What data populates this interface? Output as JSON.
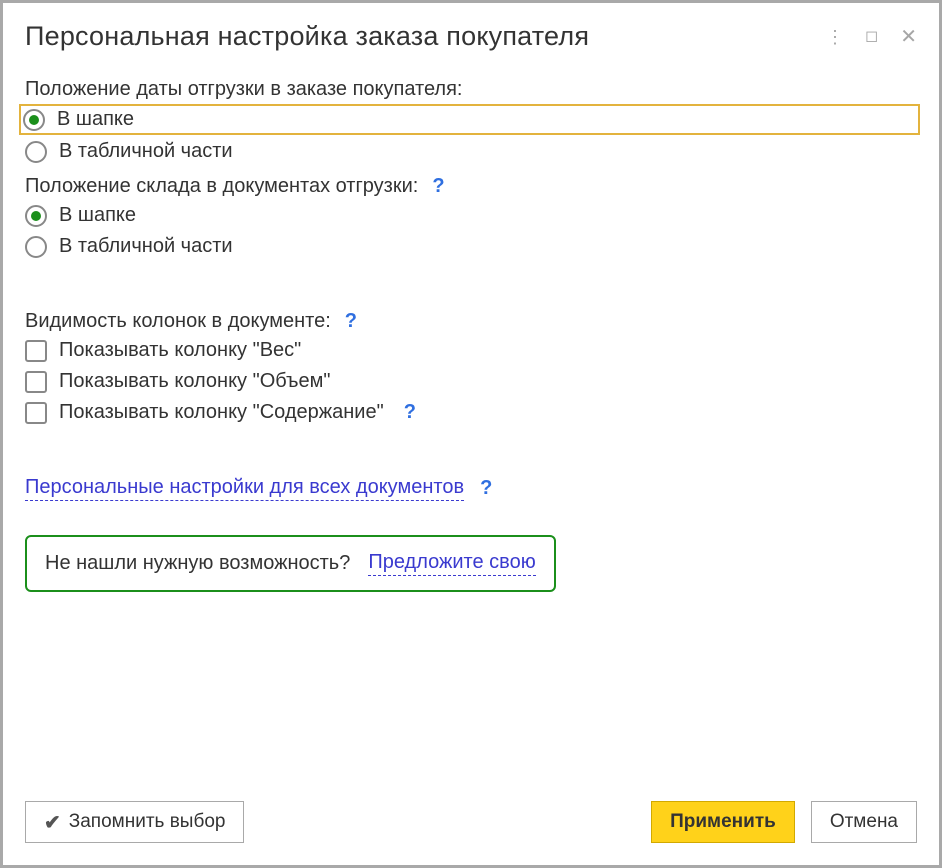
{
  "window": {
    "title": "Персональная настройка заказа покупателя"
  },
  "section1": {
    "label": "Положение даты отгрузки в заказе покупателя:",
    "opt1": "В шапке",
    "opt2": "В табличной части"
  },
  "section2": {
    "label": "Положение склада в документах отгрузки:",
    "opt1": "В шапке",
    "opt2": "В табличной части"
  },
  "section3": {
    "label": "Видимость колонок в документе:",
    "chk1": "Показывать колонку \"Вес\"",
    "chk2": "Показывать колонку \"Объем\"",
    "chk3": "Показывать колонку \"Содержание\""
  },
  "links": {
    "all_docs": "Персональные настройки для всех документов"
  },
  "suggest": {
    "text": "Не нашли нужную возможность?",
    "link": "Предложите свою"
  },
  "buttons": {
    "remember": "Запомнить выбор",
    "apply": "Применить",
    "cancel": "Отмена"
  },
  "help_glyph": "?"
}
